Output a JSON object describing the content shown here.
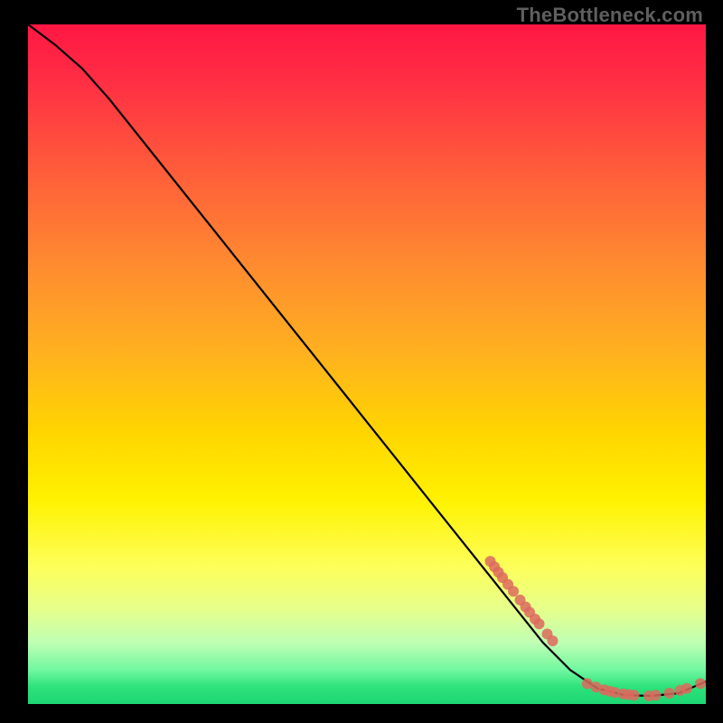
{
  "watermark": "TheBottleneck.com",
  "chart_data": {
    "type": "line",
    "title": "",
    "xlabel": "",
    "ylabel": "",
    "xlim": [
      0,
      100
    ],
    "ylim": [
      0,
      100
    ],
    "grid": false,
    "legend": false,
    "background_gradient": {
      "top": "#ff1744",
      "mid": "#ffe200",
      "bottom": "#1dd673"
    },
    "note": "Axes and gridlines not shown in original image; x/y ranges are normalized 0–100. Curve values list (x, y) in chart coordinates where y is relative height from bottom (0 = bottom/green, 100 = top/red).",
    "series": [
      {
        "name": "bottleneck-curve",
        "color": "#000000",
        "points": [
          {
            "x": 0.0,
            "y": 100.0
          },
          {
            "x": 4.0,
            "y": 97.0
          },
          {
            "x": 8.0,
            "y": 93.5
          },
          {
            "x": 12.0,
            "y": 89.0
          },
          {
            "x": 20.0,
            "y": 79.0
          },
          {
            "x": 30.0,
            "y": 66.5
          },
          {
            "x": 40.0,
            "y": 54.0
          },
          {
            "x": 50.0,
            "y": 41.5
          },
          {
            "x": 60.0,
            "y": 29.0
          },
          {
            "x": 68.0,
            "y": 19.0
          },
          {
            "x": 72.0,
            "y": 14.0
          },
          {
            "x": 76.0,
            "y": 9.0
          },
          {
            "x": 80.0,
            "y": 5.0
          },
          {
            "x": 84.0,
            "y": 2.3
          },
          {
            "x": 88.0,
            "y": 1.3
          },
          {
            "x": 92.0,
            "y": 1.2
          },
          {
            "x": 96.0,
            "y": 1.6
          },
          {
            "x": 100.0,
            "y": 3.3
          }
        ]
      }
    ],
    "marker_clusters": [
      {
        "name": "cluster-upper-slope",
        "marker_color": "#dc6a5e",
        "points": [
          {
            "x": 68.2,
            "y": 21.0
          },
          {
            "x": 68.8,
            "y": 20.2
          },
          {
            "x": 69.4,
            "y": 19.4
          },
          {
            "x": 70.0,
            "y": 18.6
          },
          {
            "x": 70.8,
            "y": 17.6
          },
          {
            "x": 71.6,
            "y": 16.6
          },
          {
            "x": 72.6,
            "y": 15.3
          },
          {
            "x": 73.4,
            "y": 14.3
          },
          {
            "x": 74.0,
            "y": 13.5
          },
          {
            "x": 74.8,
            "y": 12.5
          },
          {
            "x": 75.4,
            "y": 11.8
          },
          {
            "x": 76.6,
            "y": 10.3
          },
          {
            "x": 77.4,
            "y": 9.3
          }
        ]
      },
      {
        "name": "cluster-bottom-trough",
        "marker_color": "#dc6a5e",
        "points": [
          {
            "x": 82.5,
            "y": 3.0
          },
          {
            "x": 83.8,
            "y": 2.5
          },
          {
            "x": 85.0,
            "y": 2.1
          },
          {
            "x": 85.8,
            "y": 1.9
          },
          {
            "x": 86.6,
            "y": 1.7
          },
          {
            "x": 87.8,
            "y": 1.5
          },
          {
            "x": 88.6,
            "y": 1.4
          },
          {
            "x": 89.4,
            "y": 1.3
          },
          {
            "x": 91.6,
            "y": 1.2
          },
          {
            "x": 92.6,
            "y": 1.3
          },
          {
            "x": 94.6,
            "y": 1.6
          },
          {
            "x": 96.2,
            "y": 2.0
          },
          {
            "x": 97.2,
            "y": 2.3
          },
          {
            "x": 99.2,
            "y": 3.0
          }
        ]
      }
    ]
  }
}
